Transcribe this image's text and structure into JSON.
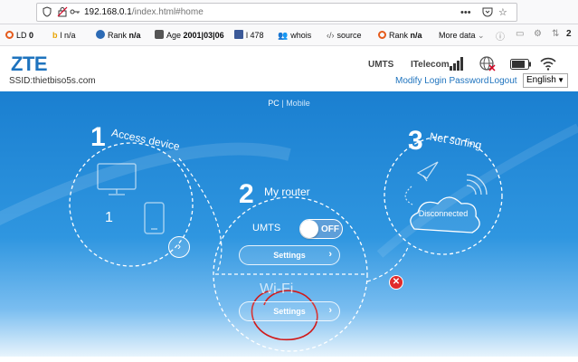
{
  "browser": {
    "url_host": "192.168.0.1",
    "url_path": "/index.html#home"
  },
  "extensions": {
    "ld_label": "LD",
    "ld_value": "0",
    "b_value": "l n/a",
    "rank1_label": "Rank",
    "rank1_value": "n/a",
    "age_label": "Age",
    "age_value": "2001|03|06",
    "fb_value": "l 478",
    "whois": "whois",
    "source": "source",
    "rank2_label": "Rank",
    "rank2_value": "n/a",
    "more": "More data",
    "count": "2"
  },
  "header": {
    "logo": "ZTE",
    "ssid": "SSID:thietbiso5s.com",
    "network_type": "UMTS",
    "operator": "ITelecom",
    "modify_password": "Modify Login Password",
    "logout": "Logout",
    "language": "English"
  },
  "view_switch": {
    "pc": "PC",
    "separator": "|",
    "mobile": "Mobile"
  },
  "steps": {
    "access": {
      "number": "1",
      "label": "Access device",
      "device_count": "1"
    },
    "router": {
      "number": "2",
      "label": "My router",
      "umts_label": "UMTS",
      "toggle_state": "OFF",
      "settings_label": "Settings",
      "wifi_label": "Wi-Fi",
      "wifi_settings_label": "Settings"
    },
    "surfing": {
      "number": "3",
      "label": "Net surfing",
      "status": "Disconnected"
    }
  },
  "colors": {
    "brand": "#1e73be",
    "background_top": "#1a7fd0",
    "disconnect_red": "#e02a2a",
    "annotation_red": "#d11a1a"
  }
}
